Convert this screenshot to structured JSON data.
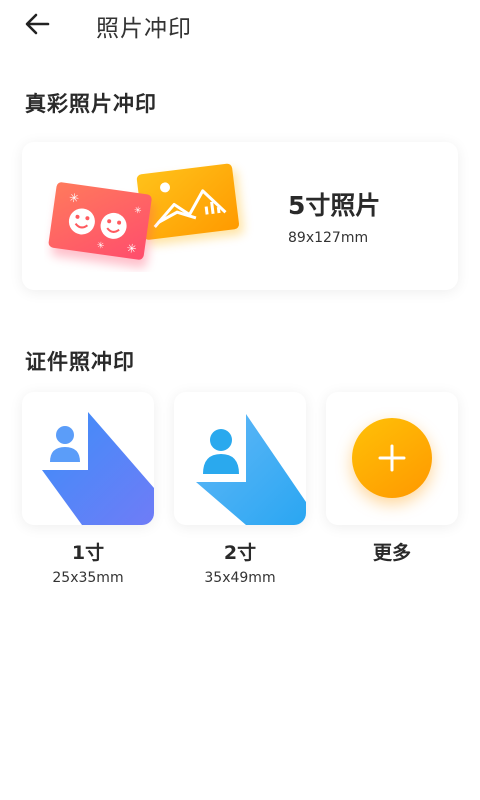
{
  "header": {
    "title": "照片冲印",
    "back_icon": "arrow-left-icon"
  },
  "sections": {
    "color_photo": {
      "title": "真彩照片冲印",
      "item": {
        "name": "5寸照片",
        "size": "89x127mm"
      }
    },
    "id_photo": {
      "title": "证件照冲印",
      "items": [
        {
          "name": "1寸",
          "size": "25x35mm"
        },
        {
          "name": "2寸",
          "size": "35x49mm"
        },
        {
          "name": "更多",
          "size": ""
        }
      ]
    }
  },
  "colors": {
    "accent_orange": "#ff9800",
    "accent_red": "#ff5a5f",
    "id_blue": "#3d8ef8",
    "id_light_blue": "#3ec8f6"
  }
}
